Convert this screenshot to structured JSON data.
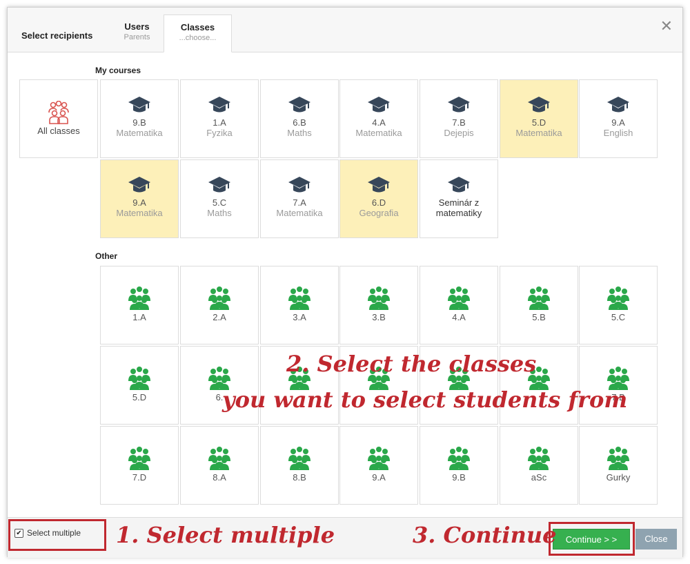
{
  "dialog": {
    "title": "Select recipients",
    "tabs": [
      {
        "label": "Users",
        "sub": "Parents"
      },
      {
        "label": "Classes",
        "sub": "...choose..."
      }
    ]
  },
  "sections": {
    "my_courses": "My courses",
    "other": "Other"
  },
  "all_classes": {
    "label": "All classes",
    "icon": "group-outline-icon",
    "color": "#d9534f"
  },
  "my_courses": [
    {
      "l1": "9.B",
      "l2": "Matematika",
      "selected": false
    },
    {
      "l1": "1.A",
      "l2": "Fyzika",
      "selected": false
    },
    {
      "l1": "6.B",
      "l2": "Maths",
      "selected": false
    },
    {
      "l1": "4.A",
      "l2": "Matematika",
      "selected": false
    },
    {
      "l1": "7.B",
      "l2": "Dejepis",
      "selected": false
    },
    {
      "l1": "5.D",
      "l2": "Matematika",
      "selected": true
    },
    {
      "l1": "9.A",
      "l2": "English",
      "selected": false
    },
    {
      "l1": "9.A",
      "l2": "Matematika",
      "selected": true
    },
    {
      "l1": "5.C",
      "l2": "Maths",
      "selected": false
    },
    {
      "l1": "7.A",
      "l2": "Matematika",
      "selected": false
    },
    {
      "l1": "6.D",
      "l2": "Geografia",
      "selected": true
    },
    {
      "l1": "Seminár z",
      "l2": "matematiky",
      "selected": false
    }
  ],
  "other_classes": [
    "1.A",
    "2.A",
    "3.A",
    "3.B",
    "4.A",
    "5.B",
    "5.C",
    "5.D",
    "6.",
    "",
    "",
    "",
    "",
    "7.B",
    "7.D",
    "8.A",
    "8.B",
    "9.A",
    "9.B",
    "aSc",
    "Gurky"
  ],
  "footer": {
    "select_multiple": "Select multiple",
    "continue": "Continue > >",
    "close": "Close"
  },
  "annotations": {
    "step1": "1. Select multiple",
    "step2_line1": "2. Select the classes",
    "step2_line2": "you want to select students from",
    "step3": "3. Continue"
  },
  "colors": {
    "selected_tile": "#fdf0b9",
    "course_icon": "#37475a",
    "class_icon": "#2aa84a",
    "annotation": "#c0282f",
    "continue_button": "#36b04f",
    "close_button": "#8fa3b0"
  }
}
